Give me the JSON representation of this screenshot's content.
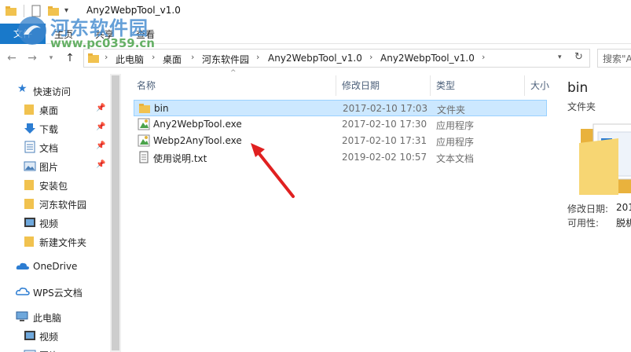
{
  "window": {
    "title": "Any2WebpTool_v1.0"
  },
  "watermark": {
    "text": "河东软件园",
    "url": "www.pc0359.cn"
  },
  "ribbon": {
    "file_tab": "文件",
    "tabs": [
      "主页",
      "共享",
      "查看"
    ]
  },
  "address": {
    "crumbs": [
      "此电脑",
      "桌面",
      "河东软件园",
      "Any2WebpTool_v1.0",
      "Any2WebpTool_v1.0"
    ],
    "search_placeholder": "搜索\"A"
  },
  "nav": {
    "items": [
      {
        "label": "快速访问",
        "icon": "star-icon",
        "pinned": false
      },
      {
        "label": "桌面",
        "icon": "folder-icon",
        "pinned": true
      },
      {
        "label": "下载",
        "icon": "download-icon",
        "pinned": true
      },
      {
        "label": "文档",
        "icon": "document-icon",
        "pinned": true
      },
      {
        "label": "图片",
        "icon": "picture-icon",
        "pinned": true
      },
      {
        "label": "安装包",
        "icon": "folder-icon",
        "pinned": false
      },
      {
        "label": "河东软件园",
        "icon": "folder-icon",
        "pinned": false
      },
      {
        "label": "视频",
        "icon": "video-icon",
        "pinned": false
      },
      {
        "label": "新建文件夹",
        "icon": "folder-icon",
        "pinned": false
      },
      {
        "label": "OneDrive",
        "icon": "cloud-icon",
        "pinned": false
      },
      {
        "label": "WPS云文档",
        "icon": "cloud-icon",
        "pinned": false
      },
      {
        "label": "此电脑",
        "icon": "computer-icon",
        "pinned": false
      },
      {
        "label": "视频",
        "icon": "video-icon",
        "pinned": false
      },
      {
        "label": "图片",
        "icon": "picture-icon",
        "pinned": false
      }
    ]
  },
  "filelist": {
    "columns": {
      "name": "名称",
      "date": "修改日期",
      "type": "类型",
      "size": "大小"
    },
    "rows": [
      {
        "name": "bin",
        "date": "2017-02-10 17:03",
        "type": "文件夹",
        "icon": "folder-icon",
        "selected": true
      },
      {
        "name": "Any2WebpTool.exe",
        "date": "2017-02-10 17:30",
        "type": "应用程序",
        "icon": "app-icon",
        "selected": false
      },
      {
        "name": "Webp2AnyTool.exe",
        "date": "2017-02-10 17:31",
        "type": "应用程序",
        "icon": "app-icon",
        "selected": false
      },
      {
        "name": "使用说明.txt",
        "date": "2019-02-02 10:57",
        "type": "文本文档",
        "icon": "text-file-icon",
        "selected": false
      }
    ]
  },
  "preview": {
    "name": "bin",
    "type": "文件夹",
    "modified_label": "修改日期:",
    "modified_value": "201",
    "availability_label": "可用性:",
    "availability_value": "脱机"
  }
}
